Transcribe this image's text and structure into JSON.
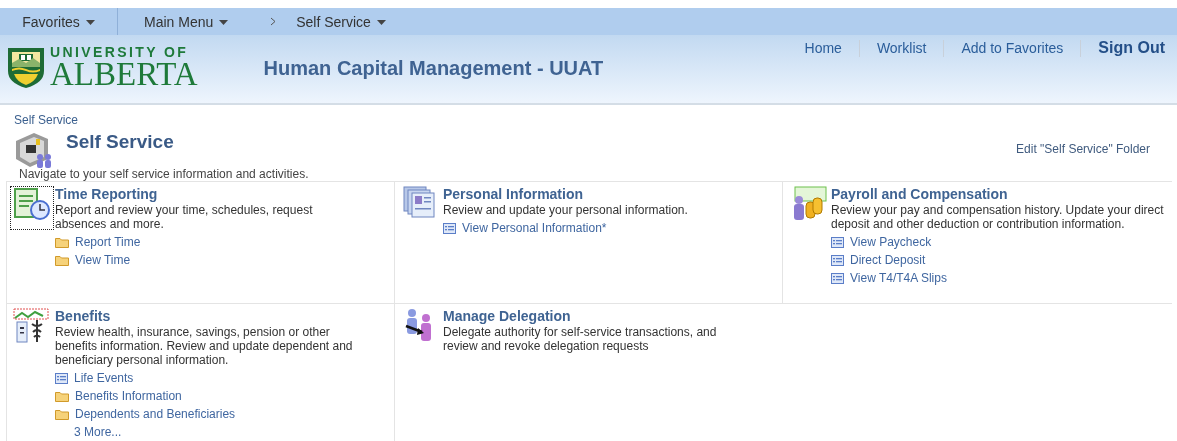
{
  "nav": [
    {
      "label": "Favorites",
      "kind": "menu"
    },
    {
      "label": "Main Menu",
      "kind": "menu"
    },
    {
      "label": "Self Service",
      "kind": "crumb"
    }
  ],
  "header": {
    "logo_top": "UNIVERSITY OF",
    "logo_bottom": "ALBERTA",
    "title": "Human Capital Management - UUAT",
    "links": [
      "Home",
      "Worklist",
      "Add to Favorites"
    ],
    "sign_out": "Sign Out"
  },
  "breadcrumb": "Self Service",
  "page": {
    "title": "Self Service",
    "description": "Navigate to your self service information and activities.",
    "edit_link": "Edit \"Self Service\" Folder"
  },
  "tiles": [
    {
      "kind": "timesheet",
      "title": "Time Reporting",
      "description": "Report and review your time, schedules, request absences and more.",
      "focused": true,
      "links": [
        {
          "kind": "folder",
          "label": "Report Time"
        },
        {
          "kind": "folder",
          "label": "View Time"
        }
      ]
    },
    {
      "kind": "documents",
      "title": "Personal Information",
      "description": "Review and update your personal information.",
      "focused": false,
      "links": [
        {
          "kind": "page",
          "label": "View Personal Information*"
        }
      ]
    },
    {
      "kind": "payroll",
      "title": "Payroll and Compensation",
      "description": "Review your pay and compensation history. Update your direct deposit and other deduction or contribution information.",
      "focused": false,
      "links": [
        {
          "kind": "page",
          "label": "View Paycheck"
        },
        {
          "kind": "page",
          "label": "Direct Deposit"
        },
        {
          "kind": "page",
          "label": "View T4/T4A Slips"
        }
      ]
    },
    {
      "kind": "benefits",
      "title": "Benefits",
      "description": "Review health, insurance, savings, pension or other benefits information. Review and update dependent and beneficiary personal information.",
      "focused": false,
      "links": [
        {
          "kind": "page",
          "label": "Life Events"
        },
        {
          "kind": "folder",
          "label": "Benefits Information"
        },
        {
          "kind": "folder",
          "label": "Dependents and Beneficiaries"
        },
        {
          "kind": "more",
          "label": "3 More..."
        }
      ]
    },
    {
      "kind": "delegation",
      "title": "Manage Delegation",
      "description": "Delegate authority for self-service transactions, and review and revoke delegation requests",
      "focused": false
    }
  ]
}
